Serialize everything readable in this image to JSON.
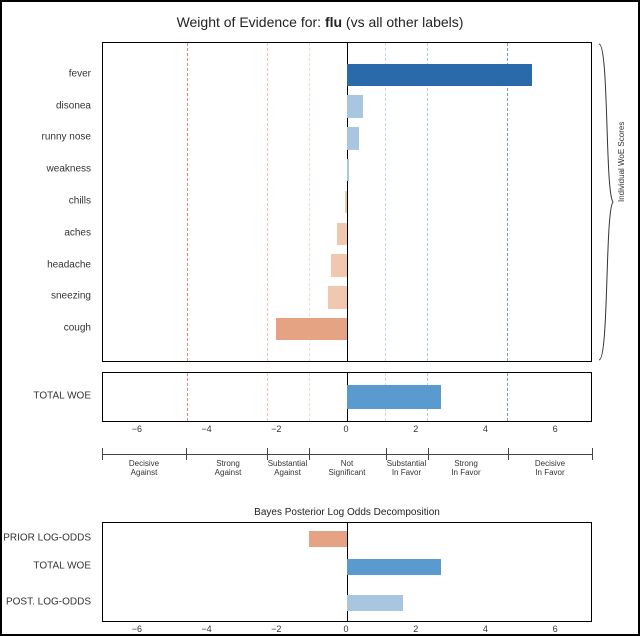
{
  "title_prefix": "Weight of Evidence for: ",
  "title_label": "flu",
  "title_suffix": " (vs all other labels)",
  "right_bracket_label": "Individual WoE Scores",
  "total_label": "TOTAL WOE",
  "bottom_title": "Bayes Posterior Log Odds Decomposition",
  "axis": {
    "min": -7,
    "max": 7
  },
  "ticks": [
    -6,
    -4,
    -2,
    0,
    2,
    4,
    6
  ],
  "ref_lines": [
    {
      "x": -4.6,
      "color": "#d1492e"
    },
    {
      "x": -2.3,
      "color": "#e6a383"
    },
    {
      "x": -1.1,
      "color": "#f2c7b0"
    },
    {
      "x": 1.1,
      "color": "#a9c6e0"
    },
    {
      "x": 2.3,
      "color": "#7fb2da"
    },
    {
      "x": 4.6,
      "color": "#2a6aab"
    }
  ],
  "qual_labels": [
    {
      "x": -5.8,
      "t1": "Decisive",
      "t2": "Against"
    },
    {
      "x": -3.4,
      "t1": "Strong",
      "t2": "Against"
    },
    {
      "x": -1.7,
      "t1": "Substantial",
      "t2": "Against"
    },
    {
      "x": 0.0,
      "t1": "Not",
      "t2": "Significant"
    },
    {
      "x": 1.7,
      "t1": "Substantial",
      "t2": "In Favor"
    },
    {
      "x": 3.4,
      "t1": "Strong",
      "t2": "In Favor"
    },
    {
      "x": 5.8,
      "t1": "Decisive",
      "t2": "In Favor"
    }
  ],
  "chart_data": {
    "type": "bar",
    "title": "Weight of Evidence for: flu (vs all other labels)",
    "xlabel": "",
    "ylabel": "",
    "xlim": [
      -7,
      7
    ],
    "orientation": "horizontal",
    "series": [
      {
        "name": "Individual WoE Scores",
        "categories": [
          "fever",
          "disonea",
          "runny nose",
          "weakness",
          "chills",
          "aches",
          "headache",
          "sneezing",
          "cough"
        ],
        "values": [
          5.3,
          0.45,
          0.35,
          0.05,
          -0.05,
          -0.3,
          -0.45,
          -0.55,
          -2.05
        ]
      },
      {
        "name": "TOTAL WOE",
        "categories": [
          "TOTAL WOE"
        ],
        "values": [
          2.7
        ]
      },
      {
        "name": "Bayes Posterior Log Odds Decomposition",
        "categories": [
          "PRIOR LOG-ODDS",
          "TOTAL WOE",
          "POST. LOG-ODDS"
        ],
        "values": [
          -1.1,
          2.7,
          1.6
        ]
      }
    ]
  },
  "top_items": [
    {
      "label": "fever",
      "value": 5.3
    },
    {
      "label": "disonea",
      "value": 0.45
    },
    {
      "label": "runny nose",
      "value": 0.35
    },
    {
      "label": "weakness",
      "value": 0.05
    },
    {
      "label": "chills",
      "value": -0.05
    },
    {
      "label": "aches",
      "value": -0.3
    },
    {
      "label": "headache",
      "value": -0.45
    },
    {
      "label": "sneezing",
      "value": -0.55
    },
    {
      "label": "cough",
      "value": -2.05
    }
  ],
  "total_value": 2.7,
  "bottom_items": [
    {
      "label": "PRIOR LOG-ODDS",
      "value": -1.1
    },
    {
      "label": "TOTAL WOE",
      "value": 2.7
    },
    {
      "label": "POST. LOG-ODDS",
      "value": 1.6
    }
  ]
}
